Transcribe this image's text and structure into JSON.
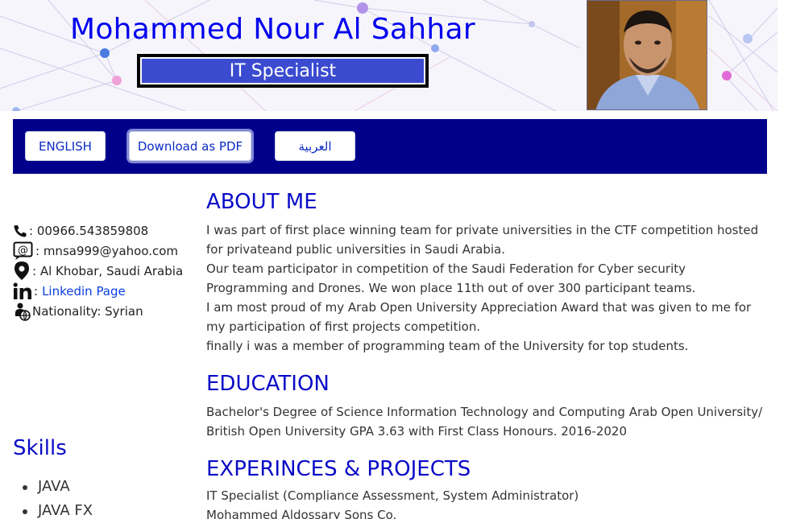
{
  "header": {
    "name": "Mohammed Nour Al Sahhar",
    "job_title": "IT Specialist",
    "photo_alt": "profile-photo"
  },
  "nav": {
    "buttons": [
      {
        "label": "ENGLISH"
      },
      {
        "label": "Download as PDF",
        "active": true
      },
      {
        "label": "العربية"
      }
    ]
  },
  "contact": {
    "phone": ": 00966.543859808",
    "email": ": mnsa999@yahoo.com",
    "address": ": Al Khobar, Saudi Arabia",
    "linkedin_prefix": ":",
    "linkedin_label": "Linkedin Page",
    "nationality": "Nationality: Syrian"
  },
  "skills": {
    "title": "Skills",
    "items": [
      "JAVA",
      "JAVA FX"
    ]
  },
  "about": {
    "title": "ABOUT ME",
    "paragraphs": [
      "I was part of first place winning team for private universities in the CTF competition hosted for privateand public universities in Saudi Arabia.",
      "Our team participator in competition of the Saudi Federation for Cyber security Programming and Drones. We won place 11th out of over 300 participant teams.",
      "I am most proud of my Arab Open University Appreciation Award that was given to me for my participation of first projects competition.",
      "finally i was a member of programming team of the University for top students."
    ]
  },
  "education": {
    "title": "EDUCATION",
    "text": "Bachelor's Degree of Science Information Technology and Computing Arab Open University/ British Open University GPA 3.63 with First Class Honours. 2016-2020"
  },
  "experience": {
    "title": "EXPERINCES & PROJECTS",
    "lines": [
      "IT Specialist (Compliance Assessment, System Administrator)",
      "Mohammed Aldossary Sons Co."
    ]
  },
  "colors": {
    "heading_blue": "#0a0ac8",
    "navbar_navy": "#00008b",
    "title_box": "#3b4bd0"
  }
}
